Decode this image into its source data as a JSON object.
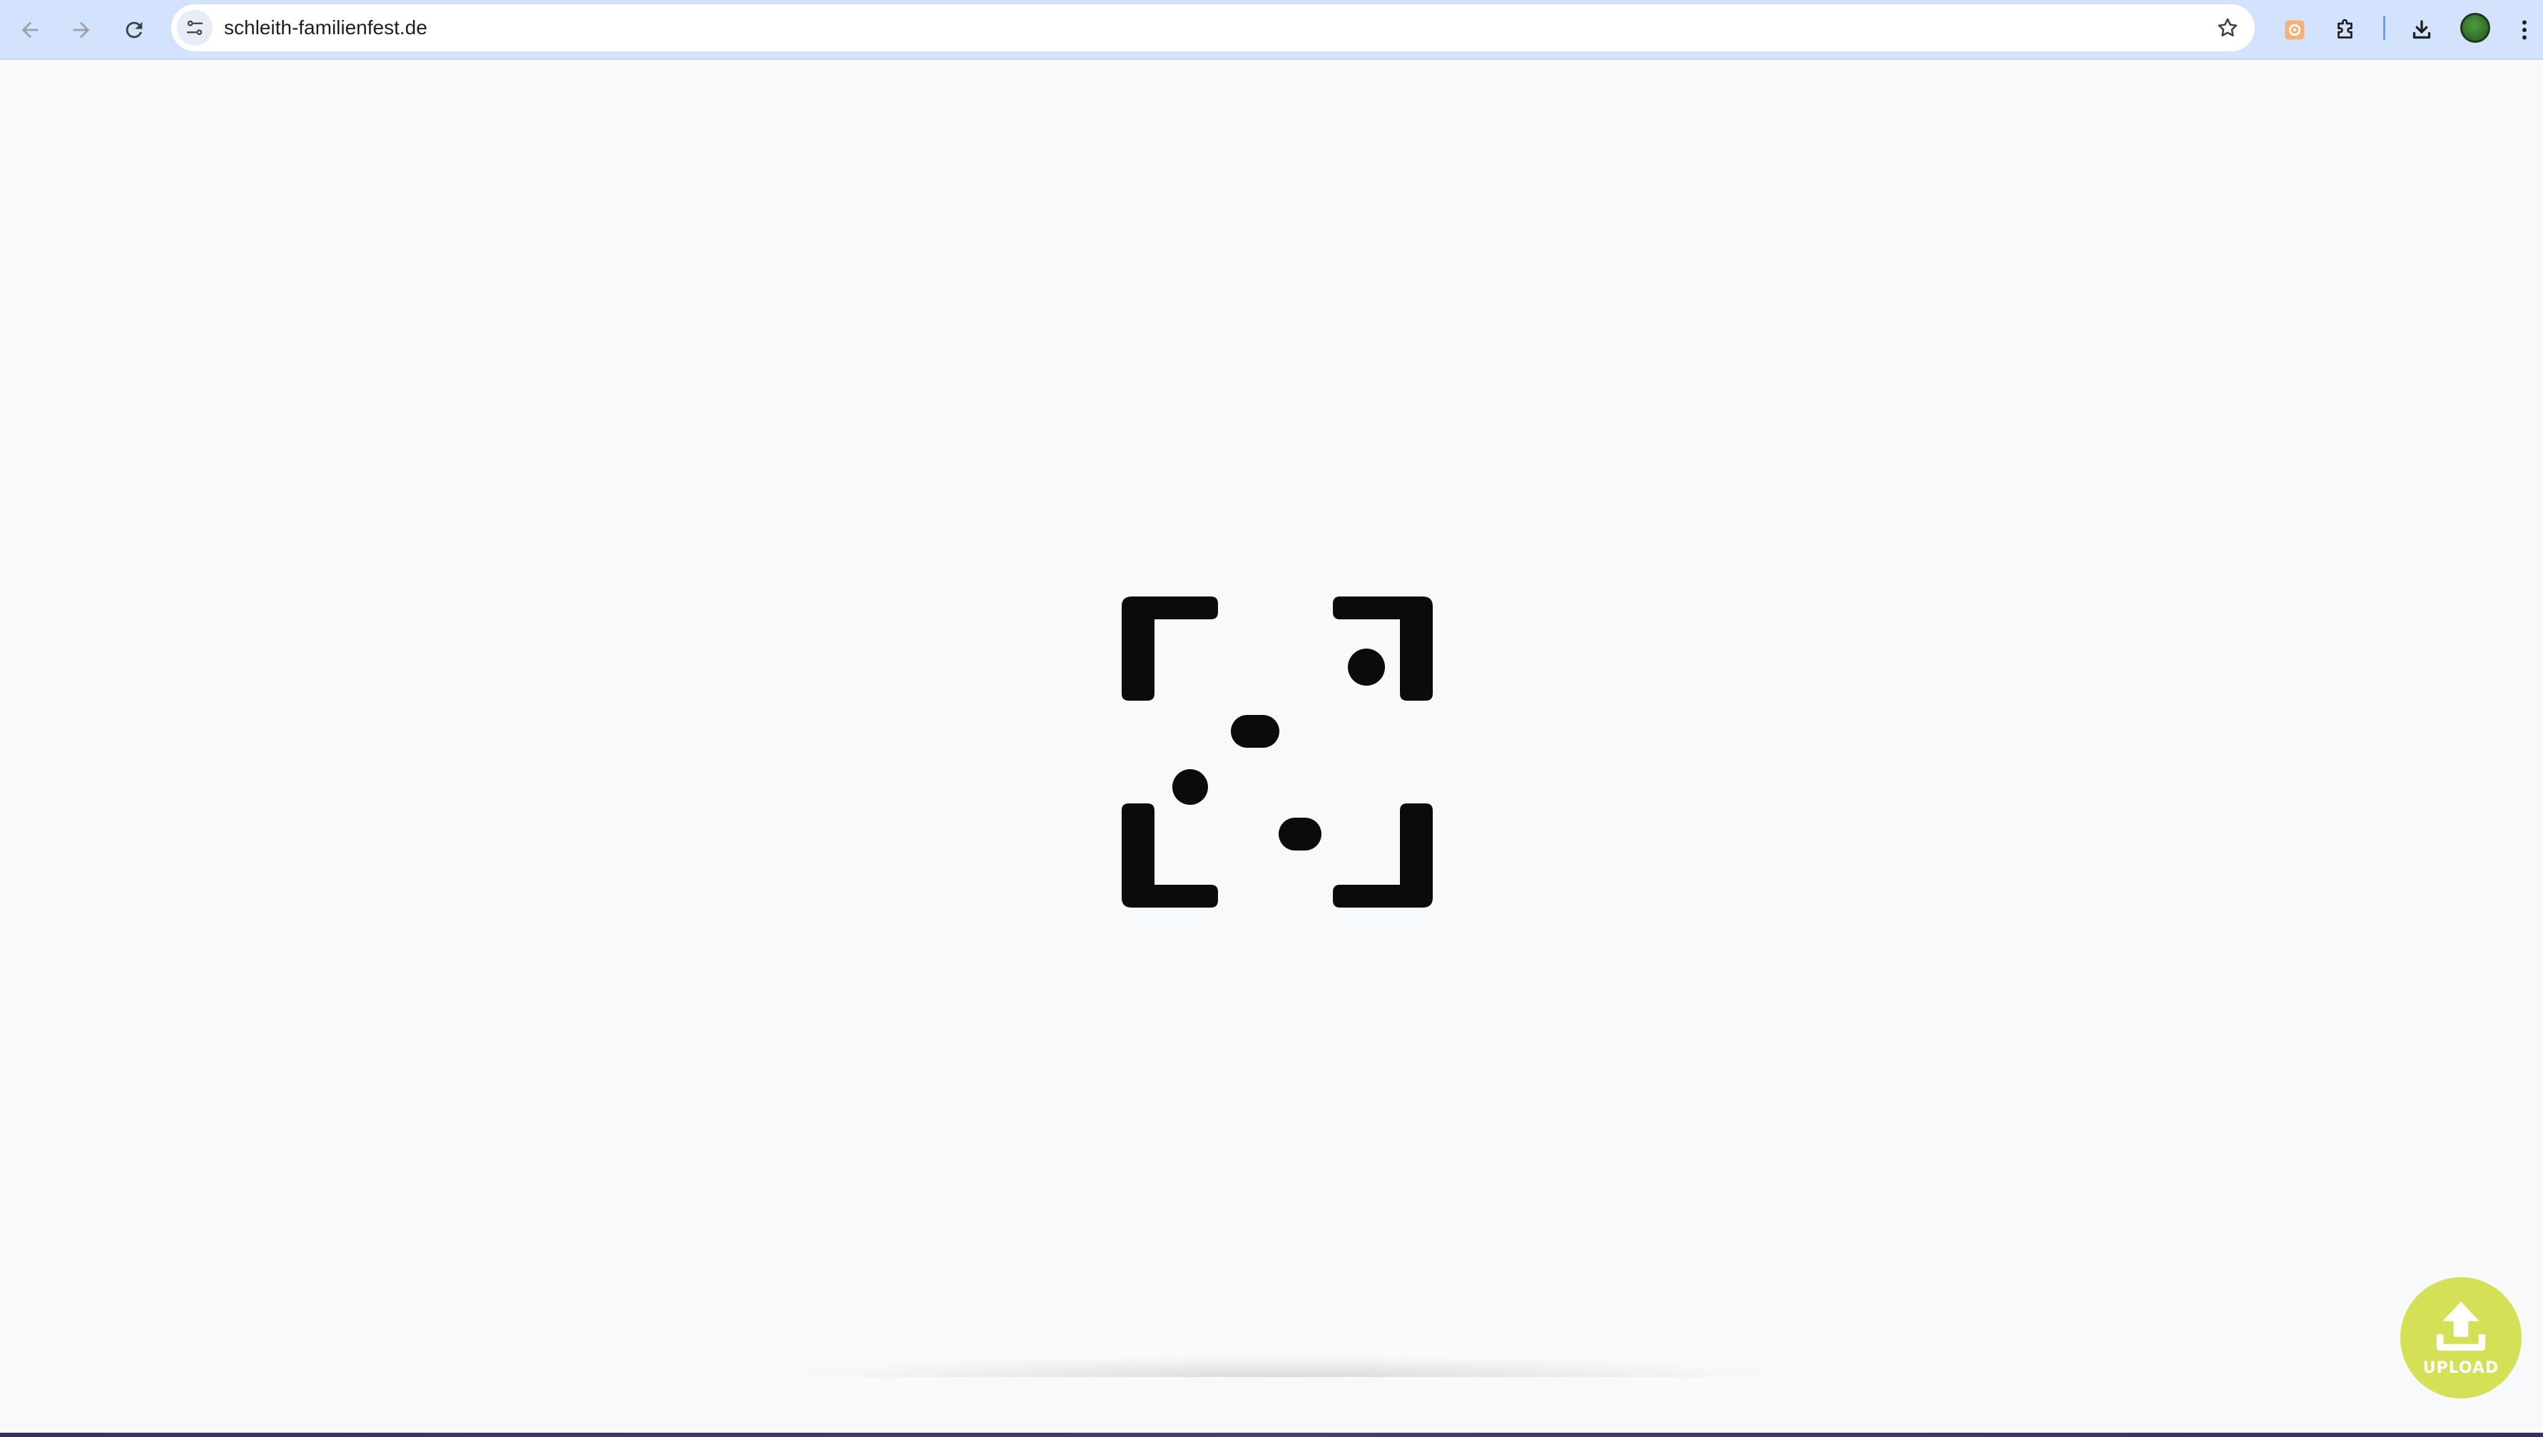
{
  "browser": {
    "url": "schleith-familienfest.de",
    "icons": {
      "back": "arrow-left-icon",
      "forward": "arrow-right-icon",
      "reload": "reload-icon",
      "site_info": "tune-icon",
      "bookmark": "star-icon",
      "extension": "extension-badge-icon",
      "extensions_menu": "puzzle-icon",
      "download": "download-icon",
      "profile": "avatar",
      "menu": "kebab-menu-icon"
    }
  },
  "page": {
    "logo_icon": "scan-frame-logo-icon",
    "upload": {
      "label": "UPLOAD",
      "icon": "upload-arrow-icon",
      "color": "#d4e157"
    }
  }
}
